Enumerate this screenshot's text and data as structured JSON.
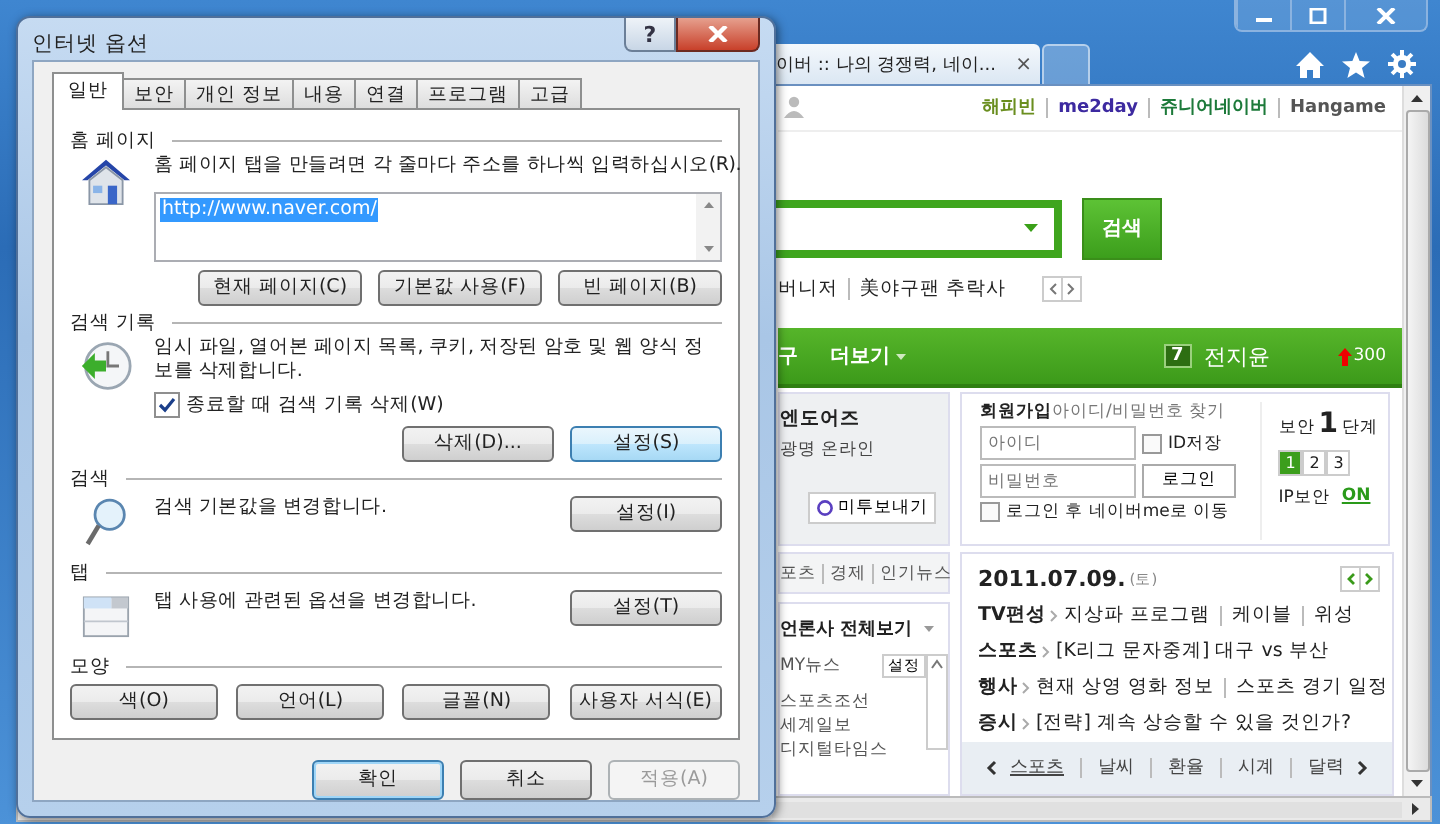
{
  "browser": {
    "tab": {
      "title": "이버 :: 나의 경쟁력, 네이...",
      "close": "×"
    },
    "top_links": [
      {
        "label": "해피빈",
        "color": "#6a8e1f"
      },
      {
        "label": "me2day",
        "color": "#3d2aa0"
      },
      {
        "label": "쥬니어네이버",
        "color": "#1d7a3a"
      },
      {
        "label": "Hangame",
        "color": "#555555"
      }
    ],
    "search_button": "검색",
    "ticker": [
      "버니저",
      "美야구팬 추락사"
    ],
    "nav": {
      "items": [
        "구",
        "더보기"
      ],
      "rank": "7",
      "keyword": "전지윤",
      "change": "300"
    },
    "promo": {
      "title": "엔도어즈",
      "subtitle": "광명 온라인",
      "button": "미투보내기"
    },
    "login": {
      "signup": "회원가입",
      "find": "아이디/비밀번호 찾기",
      "id_placeholder": "아이디",
      "save_id": {
        "label": "ID저장",
        "checked": false
      },
      "pw_placeholder": "비밀번호",
      "login_button": "로그인",
      "redirect": {
        "label": "로그인 후 네이버me로 이동",
        "checked": false
      },
      "security": {
        "prefix": "보안",
        "level": "1",
        "suffix": "단계",
        "steps": [
          {
            "label": "1",
            "selected": true
          },
          {
            "label": "2",
            "selected": false
          },
          {
            "label": "3",
            "selected": false
          }
        ]
      },
      "ip_label": "IP보안",
      "ip_state": "ON"
    },
    "news": {
      "tabs": [
        "포츠",
        "경제",
        "인기뉴스"
      ],
      "press_all": "언론사 전체보기",
      "my_news": "MY뉴스",
      "my_news_settings": "설정",
      "press": [
        "스포츠조선",
        "세계일보",
        "디지털타임스"
      ]
    },
    "today": {
      "date": "2011.07.09.",
      "weekday": "(토)",
      "lines": [
        {
          "category": "TV편성",
          "items": [
            "지상파 프로그램",
            "케이블",
            "위성"
          ]
        },
        {
          "category": "스포츠",
          "items": [
            "[K리그 문자중계] 대구 vs 부산"
          ]
        },
        {
          "category": "행사",
          "items": [
            "현재 상영 영화 정보",
            "스포츠 경기 일정"
          ]
        },
        {
          "category": "증시",
          "items": [
            "[전략] 계속 상승할 수 있을 것인가?"
          ]
        }
      ]
    },
    "bottom_tabs": [
      "스포츠",
      "날씨",
      "환율",
      "시계",
      "달력"
    ]
  },
  "dialog": {
    "title": "인터넷 옵션",
    "help": "?",
    "tabs": [
      {
        "label": "일반",
        "selected": true
      },
      {
        "label": "보안",
        "selected": false
      },
      {
        "label": "개인 정보",
        "selected": false
      },
      {
        "label": "내용",
        "selected": false
      },
      {
        "label": "연결",
        "selected": false
      },
      {
        "label": "프로그램",
        "selected": false
      },
      {
        "label": "고급",
        "selected": false
      }
    ],
    "sections": [
      {
        "kind": "home",
        "heading": "홈 페이지",
        "description": "홈 페이지 탭을 만들려면 각 줄마다 주소를 하나씩 입력하십시오(R).",
        "url": "http://www.naver.com/",
        "buttons": [
          {
            "label": "현재 페이지(C)",
            "highlighted": false
          },
          {
            "label": "기본값 사용(F)",
            "highlighted": false
          },
          {
            "label": "빈 페이지(B)",
            "highlighted": false
          }
        ]
      },
      {
        "kind": "history",
        "heading": "검색 기록",
        "description": "임시 파일, 열어본 페이지 목록, 쿠키, 저장된 암호 및 웹 양식 정보를 삭제합니다.",
        "checkbox": {
          "label": "종료할 때 검색 기록 삭제(W)",
          "checked": true
        },
        "buttons": [
          {
            "label": "삭제(D)...",
            "highlighted": false
          },
          {
            "label": "설정(S)",
            "highlighted": true
          }
        ]
      },
      {
        "kind": "search",
        "heading": "검색",
        "description": "검색 기본값을 변경합니다.",
        "buttons": [
          {
            "label": "설정(I)",
            "highlighted": false
          }
        ]
      },
      {
        "kind": "tabs",
        "heading": "탭",
        "description": "탭 사용에 관련된 옵션을 변경합니다.",
        "buttons": [
          {
            "label": "설정(T)",
            "highlighted": false
          }
        ]
      },
      {
        "kind": "appearance",
        "heading": "모양",
        "buttons": [
          {
            "label": "색(O)",
            "highlighted": false
          },
          {
            "label": "언어(L)",
            "highlighted": false
          },
          {
            "label": "글꼴(N)",
            "highlighted": false
          },
          {
            "label": "사용자 서식(E)",
            "highlighted": false
          }
        ]
      }
    ],
    "footer": [
      {
        "label": "확인",
        "default": true,
        "disabled": false
      },
      {
        "label": "취소",
        "default": false,
        "disabled": false
      },
      {
        "label": "적용(A)",
        "default": false,
        "disabled": true
      }
    ]
  }
}
